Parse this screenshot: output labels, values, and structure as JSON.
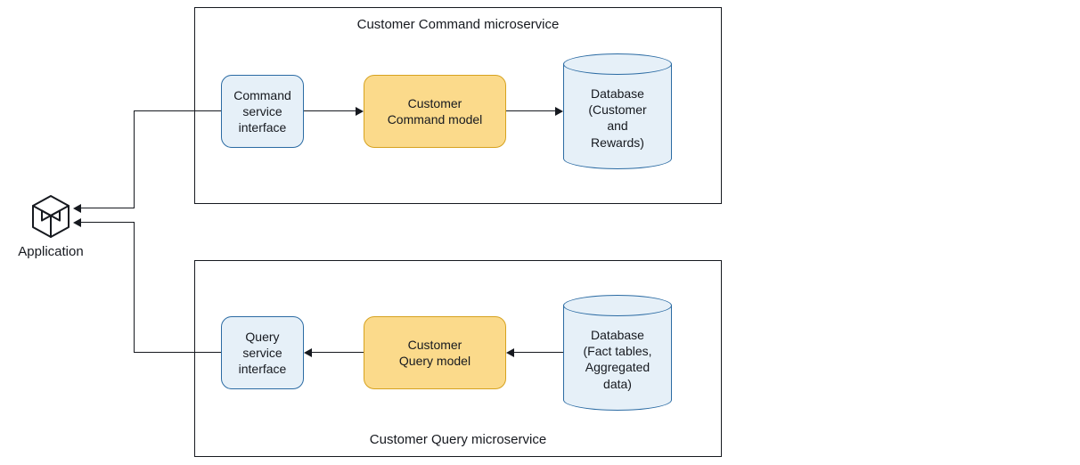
{
  "application": {
    "label": "Application"
  },
  "command_service": {
    "title": "Customer Command microservice",
    "interface_label": "Command\nservice\ninterface",
    "model_label": "Customer\nCommand model",
    "db_label": "Database\n(Customer\nand\nRewards)"
  },
  "query_service": {
    "title": "Customer Query microservice",
    "interface_label": "Query\nservice\ninterface",
    "model_label": "Customer\nQuery model",
    "db_label": "Database\n(Fact tables,\nAggregated\ndata)"
  }
}
